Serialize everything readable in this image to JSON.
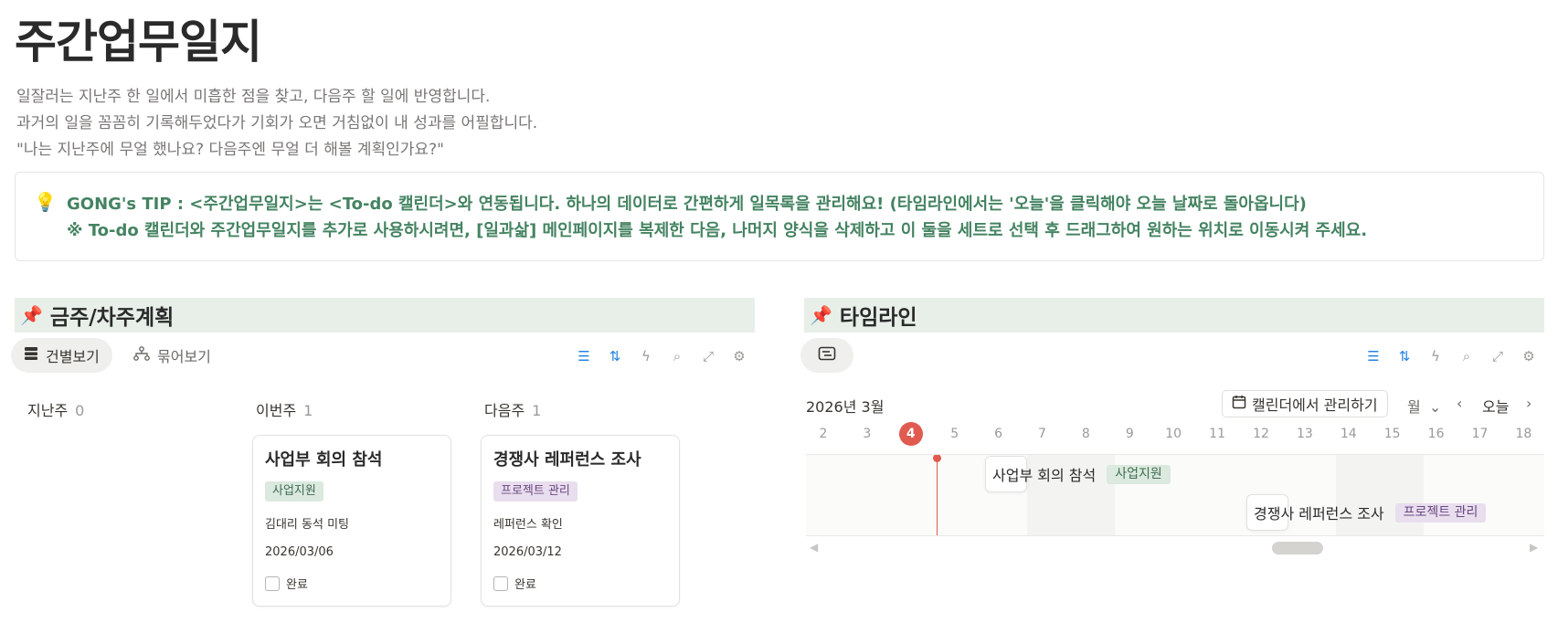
{
  "page": {
    "title": "주간업무일지",
    "description": [
      "일잘러는 지난주 한 일에서 미흡한 점을 찾고, 다음주 할 일에 반영합니다.",
      "과거의 일을 꼼꼼히 기록해두었다가 기회가 오면 거침없이 내 성과를 어필합니다.",
      "\"나는 지난주에 무얼 했나요? 다음주엔 무얼 더 해볼 계획인가요?\""
    ]
  },
  "callout": {
    "icon": "lightbulb-icon",
    "line1": "GONG's TIP : <주간업무일지>는 <To-do 캘린더>와 연동됩니다. 하나의 데이터로 간편하게 일목록을 관리해요! (타임라인에서는 '오늘'을 클릭해야 오늘 날짜로 돌아옵니다)",
    "line2": "※ To-do 캘린더와 주간업무일지를 추가로 사용하시려면, [일과삶] 메인페이지를 복제한 다음, 나머지 양식을 삭제하고 이 둘을 세트로 선택 후 드래그하여 원하는 위치로 이동시켜 주세요."
  },
  "board": {
    "heading": "금주/차주계획",
    "pin_icon": "pushpin-icon",
    "tabs": [
      {
        "label": "건별보기",
        "active": true
      },
      {
        "label": "묶어보기",
        "active": false
      }
    ],
    "columns": [
      {
        "name": "지난주",
        "count": "0"
      },
      {
        "name": "이번주",
        "count": "1"
      },
      {
        "name": "다음주",
        "count": "1"
      }
    ],
    "cards": [
      {
        "title": "사업부 회의 참석",
        "tag": "사업지원",
        "note": "김대리 동석 미팅",
        "date": "2026/03/06",
        "done_label": "완료"
      },
      {
        "title": "경쟁사 레퍼런스 조사",
        "tag": "프로젝트 관리",
        "note": "레퍼런스 확인",
        "date": "2026/03/12",
        "done_label": "완료"
      }
    ]
  },
  "timeline": {
    "heading": "타임라인",
    "month_label": "2026년 3월",
    "calendar_button": "캘린더에서 관리하기",
    "unit_select": "월",
    "today_button": "오늘",
    "days": [
      "2",
      "3",
      "4",
      "5",
      "6",
      "7",
      "8",
      "9",
      "10",
      "11",
      "12",
      "13",
      "14",
      "15",
      "16",
      "17",
      "18"
    ],
    "today_day": "4",
    "items": [
      {
        "title": "사업부 회의 참석",
        "tag": "사업지원"
      },
      {
        "title": "경쟁사 레퍼런스 조사",
        "tag": "프로젝트 관리"
      }
    ]
  },
  "colors": {
    "callout_text": "#448361",
    "section_bg": "#e8efe9",
    "today": "#e05a4f",
    "accent_blue": "#2383e2",
    "tag_green_bg": "#dbe9df",
    "tag_purple_bg": "#e8deee"
  }
}
